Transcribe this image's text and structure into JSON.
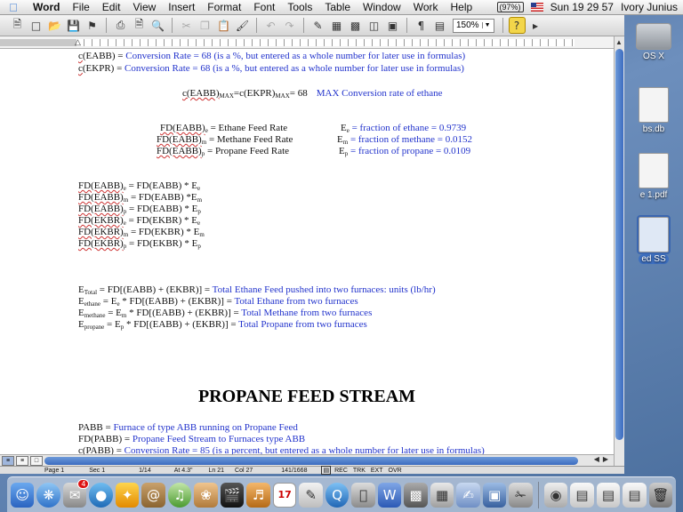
{
  "menubar": {
    "app": "Word",
    "menus": [
      "File",
      "Edit",
      "View",
      "Insert",
      "Format",
      "Font",
      "Tools",
      "Table",
      "Window",
      "Work",
      "Help"
    ],
    "battery": "(97%)",
    "clock": "Sun 19 29 57",
    "user": "Ivory Junius"
  },
  "toolbar": {
    "zoom": "150%"
  },
  "desktop": {
    "items": [
      {
        "label": "OS X"
      },
      {
        "label": "bs.db"
      },
      {
        "label": "e 1.pdf"
      },
      {
        "label": "ed SS"
      }
    ]
  },
  "doc": {
    "l1": {
      "a": "c",
      "b": "(EABB) = ",
      "c": "Conversion Rate = 68 (is a %, but entered as a whole number for later use in formulas)"
    },
    "l2": {
      "a": "c",
      "b": "(EKPR) = ",
      "c": "Conversion Rate = 68 (is a %, but entered as a whole number for later use in formulas)"
    },
    "max": {
      "a": "c(EABB)",
      "s1": "MAX",
      "b": "=c(EKPR)",
      "s2": "MAX",
      "c": "= 68",
      "d": "MAX Conversion rate of ethane"
    },
    "feed": [
      {
        "a": "FD(EABB)",
        "s": "e",
        "b": " = Ethane Feed Rate",
        "ea": "E",
        "es": "e",
        "eb": " = fraction of ethane = 0.9739"
      },
      {
        "a": "FD(EABB)",
        "s": "m",
        "b": " = Methane Feed Rate",
        "ea": "E",
        "es": "m",
        "eb": " = fraction of methane = 0.0152"
      },
      {
        "a": "FD(EABB)",
        "s": "p",
        "b": " = Propane Feed Rate",
        "ea": "E",
        "es": "p",
        "eb": " = fraction of propane = 0.0109"
      }
    ],
    "eqs": [
      {
        "a": "FD(EABB)",
        "s": "e",
        "b": " = FD(EABB) * E",
        "t": "e"
      },
      {
        "a": "FD(EABB)",
        "s": "m",
        "b": " = FD(EABB) *E",
        "t": "m"
      },
      {
        "a": "FD(EABB)",
        "s": "p",
        "b": " = FD(EABB)  * E",
        "t": "p"
      },
      {
        "a": "FD(EKBR)",
        "s": "e",
        "b": " = FD(EKBR)  * E",
        "t": "e"
      },
      {
        "a": "FD(EKBR)",
        "s": "m",
        "b": " = FD(EKBR) * E",
        "t": "m"
      },
      {
        "a": "FD(EKBR)",
        "s": "p",
        "b": " = FD(EKBR) * E",
        "t": "p"
      }
    ],
    "totals": [
      {
        "a": "E",
        "s": "Total",
        "b": " = FD[(EABB) + (EKBR)]  = ",
        "c": "Total Ethane Feed pushed into two furnaces: units (lb/hr)"
      },
      {
        "a": "E",
        "s": "ethane",
        "b": " = E",
        "s2": "e",
        "b2": " * FD[(EABB) + (EKBR)]  = ",
        "c": "Total Ethane from two furnaces"
      },
      {
        "a": "E",
        "s": "methane",
        "b": " = E",
        "s2": "m",
        "b2": " * FD[(EABB) + (EKBR)] = ",
        "c": "Total Methane from two furnaces"
      },
      {
        "a": "E",
        "s": "propane",
        "b": " = E",
        "s2": "p",
        "b2": " * FD[(EABB) + (EKBR)]  = ",
        "c": "Total Propane from two furnaces"
      }
    ],
    "heading": "PROPANE FEED STREAM",
    "p1": {
      "a": "PABB = ",
      "c": "Furnace of type ABB running on Propane Feed"
    },
    "p2": {
      "a": "FD(PABB) = ",
      "c": "Propane Feed Stream to Furnaces type ABB"
    },
    "p3": {
      "a": "c",
      "b": "(PABB) =  ",
      "c": "Conversion Rate = 85 (is a percent, but entered as a whole number for later use in formulas)"
    }
  },
  "status": {
    "page": "Page 1",
    "sec": "Sec 1",
    "count": "1/14",
    "at": "At 4.3\"",
    "ln": "Ln 21",
    "col": "Col 27",
    "words": "141/1668",
    "rec": "REC",
    "trk": "TRK",
    "ext": "EXT",
    "ovr": "OVR"
  },
  "dock": {
    "badge": "4",
    "calendar_day": "17"
  }
}
